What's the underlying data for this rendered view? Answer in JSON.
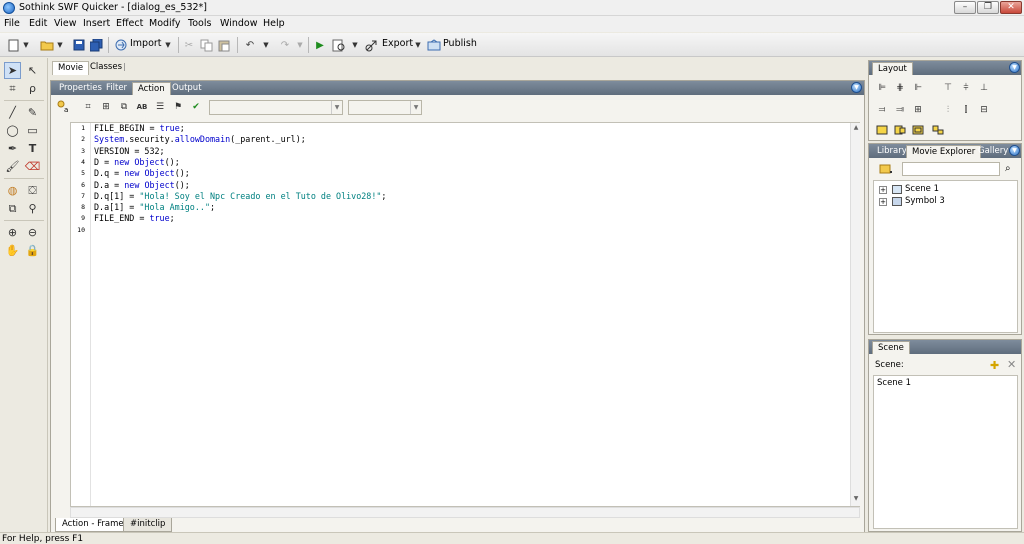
{
  "window": {
    "title": "Sothink SWF Quicker - [dialog_es_532*]",
    "min_label": "–",
    "max_label": "❐",
    "close_label": "✕"
  },
  "menu": [
    "File",
    "Edit",
    "View",
    "Insert",
    "Effect",
    "Modify",
    "Tools",
    "Window",
    "Help"
  ],
  "toolbar": {
    "import_label": "Import",
    "export_label": "Export",
    "publish_label": "Publish"
  },
  "doc_tabs": [
    "Movie",
    "Classes"
  ],
  "panel_tabs": [
    "Properties",
    "Filter",
    "Action",
    "Output"
  ],
  "code_lines": [
    "FILE_BEGIN = true;",
    "System.security.allowDomain(_parent._url);",
    "VERSION = 532;",
    "D = new Object();",
    "D.q = new Object();",
    "D.a = new Object();",
    "D.q[1] = \"Hola! Soy el Npc Creado en el Tuto de Olivo28!\";",
    "D.a[1] = \"Hola Amigo..\";",
    "FILE_END = true;",
    ""
  ],
  "line_numbers": [
    "1",
    "2",
    "3",
    "4",
    "5",
    "6",
    "7",
    "8",
    "9",
    "10"
  ],
  "bottom_tabs": [
    "Action - Frame",
    "#initclip"
  ],
  "layout_panel": {
    "title": "Layout"
  },
  "library_panel": {
    "tabs": [
      "Library",
      "Movie Explorer",
      "Gallery"
    ],
    "tree": [
      "Scene 1",
      "Symbol 3"
    ]
  },
  "scene_panel": {
    "title": "Scene",
    "label": "Scene:",
    "items": [
      "Scene 1"
    ]
  },
  "status": "For Help, press F1",
  "colors": {
    "keyword": "#0000cc",
    "string": "#008080",
    "panel_header": "#6e7c8c"
  }
}
